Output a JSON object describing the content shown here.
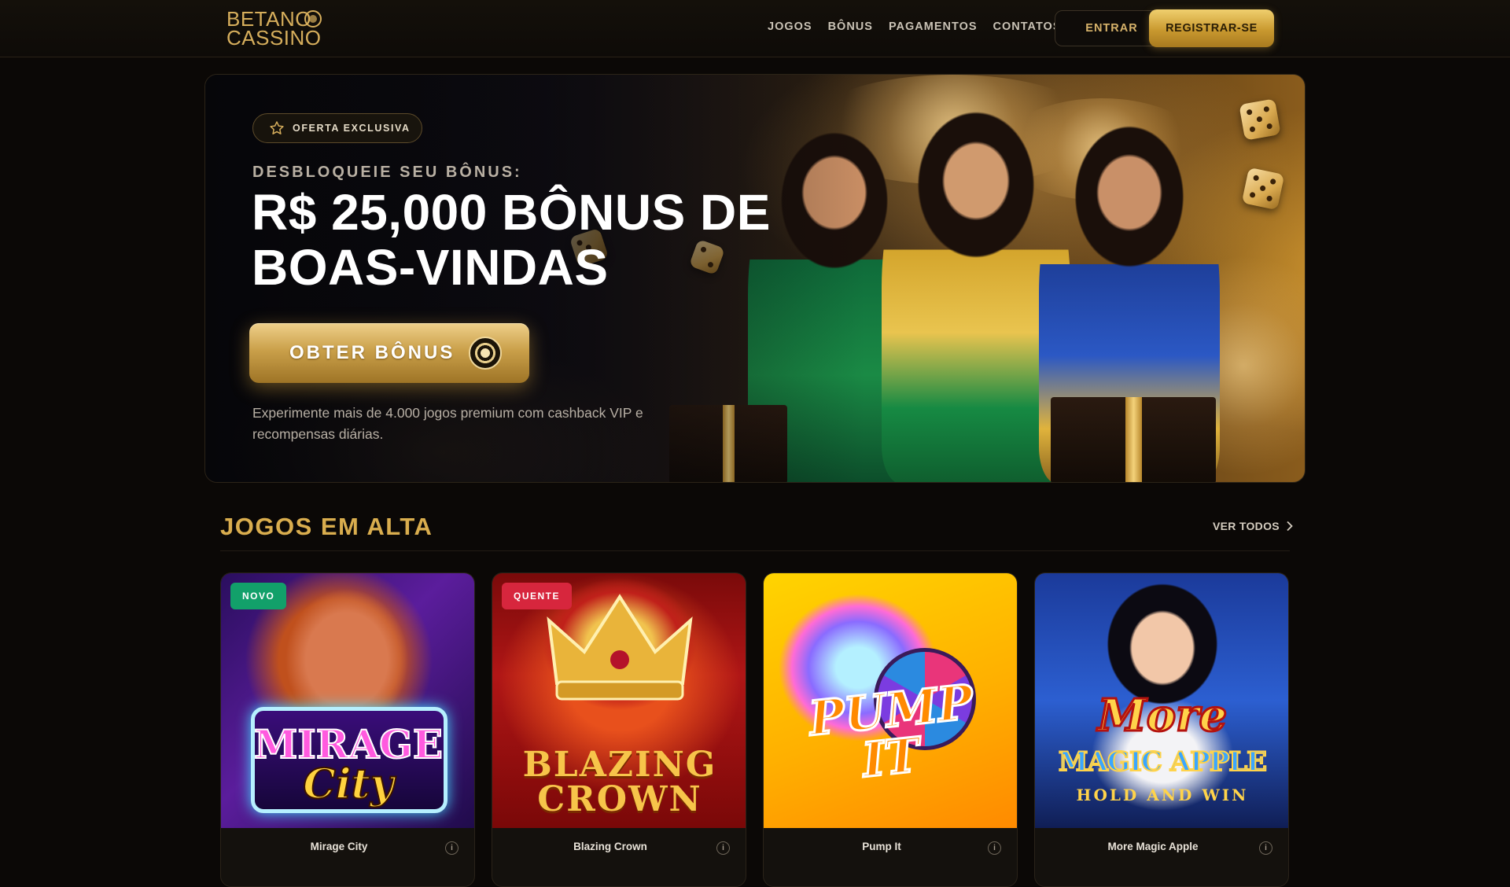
{
  "brand": {
    "line1": "BETANO",
    "line2": "CASSINO"
  },
  "nav": {
    "items": [
      "JOGOS",
      "BÔNUS",
      "PAGAMENTOS",
      "CONTATOS"
    ],
    "login_label": "ENTRAR",
    "register_label": "REGISTRAR-SE"
  },
  "hero": {
    "badge": "OFERTA EXCLUSIVA",
    "kicker": "DESBLOQUEIE SEU BÔNUS:",
    "title_line1": "R$ 25,000 BÔNUS DE",
    "title_line2": "BOAS-VINDAS",
    "cta_label": "OBTER BÔNUS",
    "description": "Experimente mais de 4.000 jogos premium com cashback VIP e recompensas diárias."
  },
  "trending": {
    "title": "JOGOS EM ALTA",
    "see_all": "VER TODOS",
    "games": [
      {
        "name": "Mirage City",
        "tag": "NOVO",
        "tag_color": "#12a06a",
        "art_line1": "MIRAGE",
        "art_line2": "City"
      },
      {
        "name": "Blazing Crown",
        "tag": "QUENTE",
        "tag_color": "#d7263d",
        "art_line1": "BLAZING",
        "art_line2": "CROWN"
      },
      {
        "name": "Pump It",
        "tag": "",
        "tag_color": "",
        "art_line1": "PUMP",
        "art_line2": "IT"
      },
      {
        "name": "More Magic Apple",
        "tag": "",
        "tag_color": "",
        "art_line1": "More",
        "art_line2": "MAGIC APPLE",
        "art_line3": "HOLD AND WIN"
      }
    ]
  },
  "colors": {
    "accent_gold": "#d9ad4e",
    "background": "#0b0806",
    "tag_new": "#12a06a",
    "tag_hot": "#d7263d"
  }
}
